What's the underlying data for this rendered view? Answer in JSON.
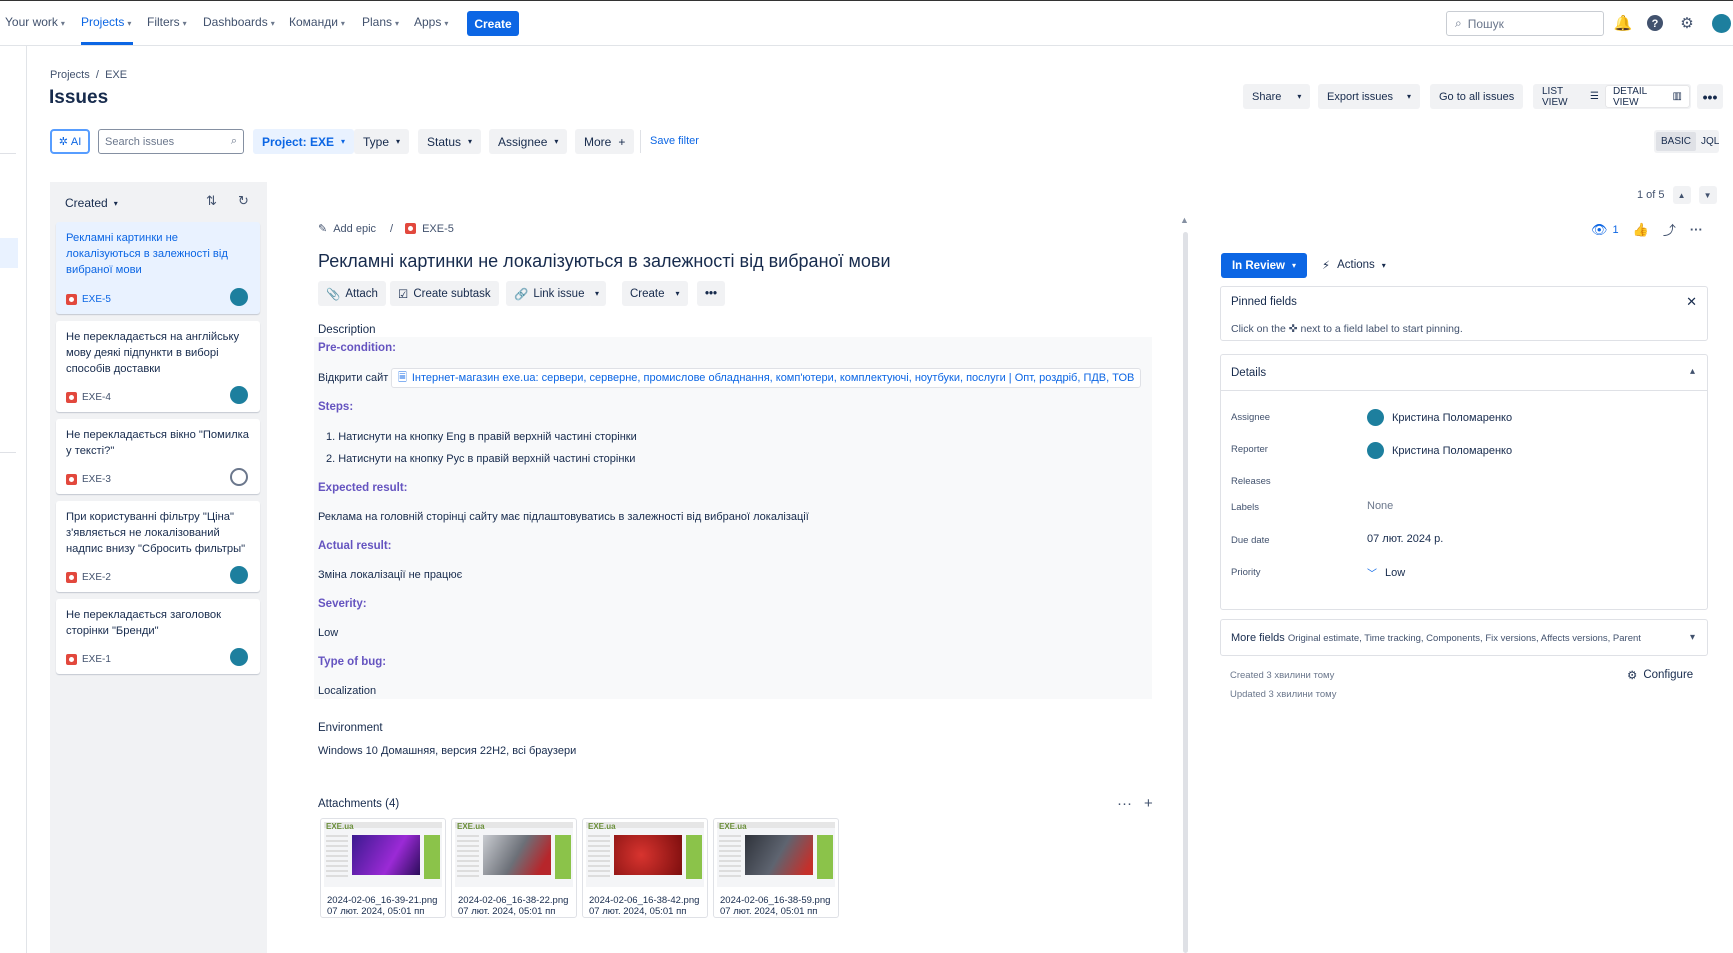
{
  "nav": {
    "items": [
      "Your work",
      "Projects",
      "Filters",
      "Dashboards",
      "Команди",
      "Plans",
      "Apps"
    ],
    "create": "Create",
    "search_placeholder": "Пошук"
  },
  "breadcrumb": {
    "root": "Projects",
    "sep": "/",
    "project": "EXE"
  },
  "page_title": "Issues",
  "header_buttons": {
    "share": "Share",
    "export": "Export issues",
    "go_all": "Go to all issues",
    "list_view": "LIST VIEW",
    "detail_view": "DETAIL VIEW",
    "more": "•••"
  },
  "filters": {
    "ai": "AI",
    "search_placeholder": "Search issues",
    "project": "Project: EXE",
    "type": "Type",
    "status": "Status",
    "assignee": "Assignee",
    "more": "More",
    "save_filter": "Save filter",
    "basic": "BASIC",
    "jql": "JQL"
  },
  "list": {
    "sort_label": "Created",
    "items": [
      {
        "title": "Рекламні картинки не локалізуються в залежності від вибраної мови",
        "key": "EXE-5"
      },
      {
        "title": "Не перекладається на англійську мову деякі підпункти в виборі способів доставки",
        "key": "EXE-4"
      },
      {
        "title": "Не перекладається вікно \"Помилка у тексті?\"",
        "key": "EXE-3"
      },
      {
        "title": "При користуванні фільтру \"Ціна\" з'являється не локалізований надпис внизу \"Сбросить фильтры\"",
        "key": "EXE-2"
      },
      {
        "title": "Не перекладається заголовок сторінки \"Бренди\"",
        "key": "EXE-1"
      }
    ]
  },
  "issue": {
    "add_epic": "Add epic",
    "sep": "/",
    "key": "EXE-5",
    "title": "Рекламні картинки не локалізуються в залежності від вибраної мови",
    "actions": {
      "attach": "Attach",
      "subtask": "Create subtask",
      "link": "Link issue",
      "create": "Create",
      "more": "•••"
    },
    "description_label": "Description",
    "precondition_head": "Pre-condition:",
    "precondition_text": "Відкрити сайт",
    "precondition_link": "Інтернет-магазин exe.ua: сервери, серверне, промислове обладнання, комп'ютери, комплектуючі, ноутбуки, послуги | Опт, роздріб, ПДВ, ТОВ",
    "steps_head": "Steps:",
    "steps": [
      "1. Натиснути на кнопку Eng в правій верхній частині сторінки",
      "2. Натиснути на кнопку Рус в правій верхній частині сторінки"
    ],
    "expected_head": "Expected result:",
    "expected_text": "Реклама на головній сторінці сайту має підлаштовуватись в залежності від вибраної локалізації",
    "actual_head": "Actual result:",
    "actual_text": "Зміна локалізації не працює",
    "severity_head": "Severity:",
    "severity_text": "Low",
    "type_head": "Type of bug:",
    "type_text": "Localization",
    "environment_label": "Environment",
    "environment_text": "Windows 10 Домашняя, версия 22H2, всі браузери",
    "attachments_label": "Attachments (4)",
    "attachments": [
      {
        "name": "2024-02-06_16-39-21.png",
        "date": "07 лют. 2024, 05:01 пп",
        "color": "#5b2cc9"
      },
      {
        "name": "2024-02-06_16-38-22.png",
        "date": "07 лют. 2024, 05:01 пп",
        "color": "#8c8f96"
      },
      {
        "name": "2024-02-06_16-38-42.png",
        "date": "07 лют. 2024, 05:01 пп",
        "color": "#b31b1b"
      },
      {
        "name": "2024-02-06_16-38-59.png",
        "date": "07 лют. 2024, 05:01 пп",
        "color": "#4a4f59"
      }
    ]
  },
  "side": {
    "pager": "1 of 5",
    "watchers": "1",
    "status": "In Review",
    "actions": "Actions",
    "pinned_title": "Pinned fields",
    "pinned_text": "Click on the ✜ next to a field label to start pinning.",
    "details_title": "Details",
    "fields": {
      "assignee_label": "Assignee",
      "assignee": "Кристина Поломаренко",
      "reporter_label": "Reporter",
      "reporter": "Кристина Поломаренко",
      "releases_label": "Releases",
      "labels_label": "Labels",
      "labels": "None",
      "due_label": "Due date",
      "due": "07 лют. 2024 р.",
      "priority_label": "Priority",
      "priority": "Low"
    },
    "more_fields": "More fields",
    "more_fields_sub": "Original estimate, Time tracking, Components, Fix versions, Affects versions, Parent",
    "created": "Created 3 хвилини тому",
    "updated": "Updated 3 хвилини тому",
    "configure": "Configure"
  }
}
